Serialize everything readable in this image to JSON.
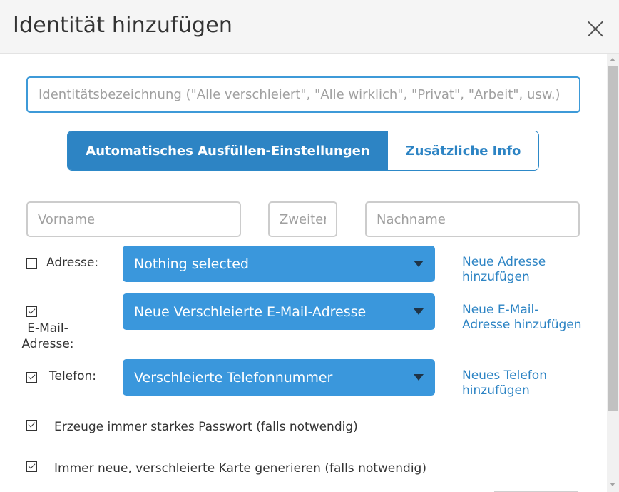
{
  "dialog": {
    "title": "Identität hinzufügen",
    "close_icon": "close-icon"
  },
  "identity_name": {
    "value": "",
    "placeholder": "Identitätsbezeichnung (\"Alle verschleiert\", \"Alle wirklich\", \"Privat\", \"Arbeit\", usw.)"
  },
  "tabs": [
    {
      "label": "Automatisches Ausfüllen-Einstellungen",
      "active": true
    },
    {
      "label": "Zusätzliche Info",
      "active": false
    }
  ],
  "name_fields": {
    "first_placeholder": "Vorname",
    "middle_placeholder": "Zweiter",
    "last_placeholder": "Nachname"
  },
  "address": {
    "checked": false,
    "label": "Adresse:",
    "selected": "Nothing selected",
    "link": "Neue Adresse hinzufügen"
  },
  "email": {
    "checked": true,
    "label": "E-Mail-Adresse:",
    "selected": "Neue Verschleierte E-Mail-Adresse",
    "link": "Neue E-Mail-Adresse hinzufügen"
  },
  "phone": {
    "checked": true,
    "label": "Telefon:",
    "selected": "Verschleierte Telefonnummer",
    "link": "Neues Telefon hinzufügen"
  },
  "options": [
    {
      "checked": true,
      "label": "Erzeuge immer starkes Passwort (falls notwendig)"
    },
    {
      "checked": true,
      "label": "Immer neue, verschleierte Karte generieren (falls notwendig)"
    }
  ],
  "colors": {
    "accent": "#3a97dc",
    "tab_active": "#2d84c4",
    "link": "#2d84c4",
    "caret": "#1f3447"
  }
}
